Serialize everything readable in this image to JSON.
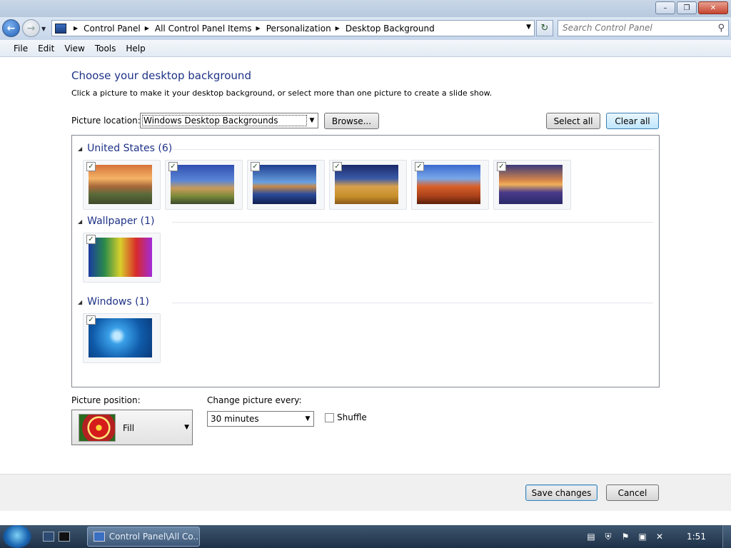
{
  "window": {
    "buttons": {
      "minimize": "–",
      "maximize": "❐",
      "close": "✕"
    }
  },
  "nav": {
    "back_icon": "←",
    "forward_icon": "→",
    "breadcrumbs": [
      "Control Panel",
      "All Control Panel Items",
      "Personalization",
      "Desktop Background"
    ],
    "search_placeholder": "Search Control Panel"
  },
  "menu": [
    "File",
    "Edit",
    "View",
    "Tools",
    "Help"
  ],
  "page": {
    "title": "Choose your desktop background",
    "description": "Click a picture to make it your desktop background, or select more than one picture to create a slide show.",
    "location_label": "Picture location:",
    "location_value": "Windows Desktop Backgrounds",
    "browse_label": "Browse...",
    "select_all_label": "Select all",
    "clear_all_label": "Clear all"
  },
  "groups": [
    {
      "name": "United States (6)",
      "thumbs": [
        "sunset-valley",
        "lighthouse",
        "rock-lake",
        "hay-bale",
        "arch",
        "lake-flowers"
      ]
    },
    {
      "name": "Wallpaper (1)",
      "thumbs": [
        "rainbow-gradient"
      ]
    },
    {
      "name": "Windows (1)",
      "thumbs": [
        "windows-logo"
      ]
    }
  ],
  "options": {
    "position_label": "Picture position:",
    "position_value": "Fill",
    "interval_label": "Change picture every:",
    "interval_value": "30 minutes",
    "shuffle_label": "Shuffle",
    "shuffle_checked": false
  },
  "footer": {
    "save_label": "Save changes",
    "cancel_label": "Cancel"
  },
  "taskbar": {
    "task_label": "Control Panel\\All Co...",
    "clock": "1:51"
  }
}
